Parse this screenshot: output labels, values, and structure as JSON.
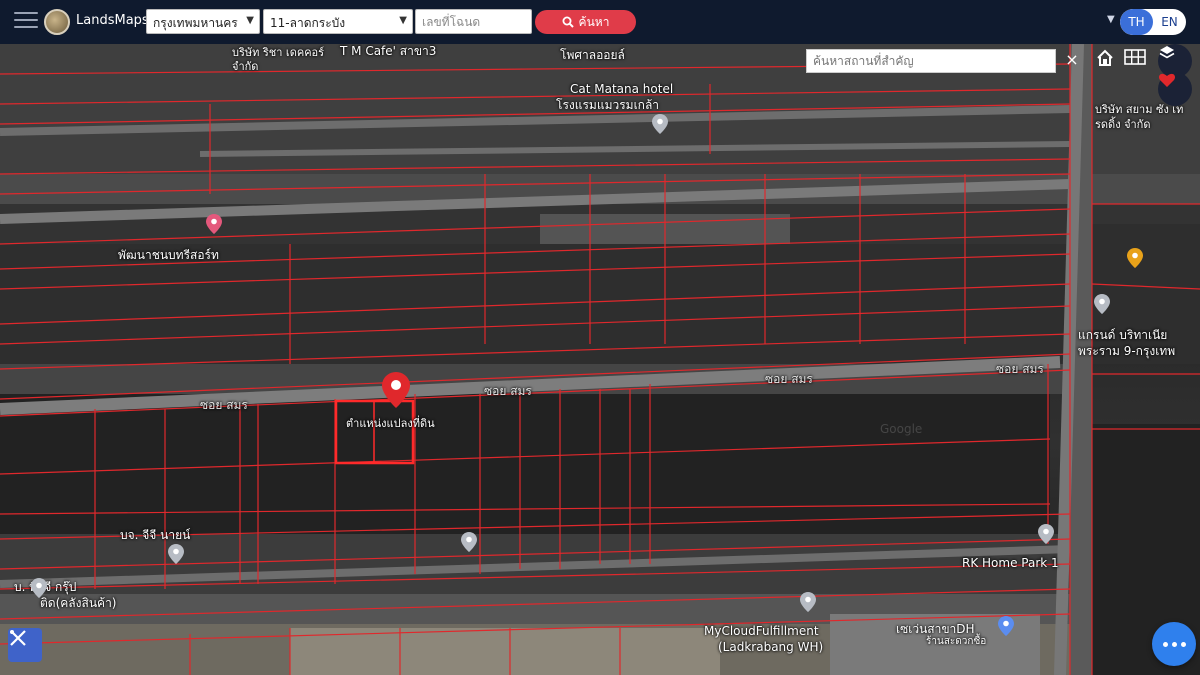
{
  "app": {
    "name": "LandsMaps"
  },
  "topbar": {
    "province": "กรุงเทพมหานคร",
    "district": "11-ลาดกระบัง",
    "deed_placeholder": "เลขที่โฉนด",
    "search_label": "ค้นหา",
    "lang_th": "TH",
    "lang_en": "EN"
  },
  "map": {
    "place_search_placeholder": "ค้นหาสถานที่สำคัญ",
    "close_label": "×",
    "parcel_marker_label": "ตำแหน่งแปลงที่ดิน",
    "labels": {
      "cafe": "T M Cafe' สาขา3",
      "decor": "บริษัท ริชา เดคคอร์ จำกัด",
      "hospital": "โพศาลออยล์",
      "cat_hotel_en": "Cat Matana hotel",
      "cat_hotel_th": "โรงแรมแมวรมเกล้า",
      "resort": "พัฒนาชนบทรีสอร์ท",
      "company_right": "บริษัท สยาม ซัง เทรดดิ้ง จำกัด",
      "grand_1": "แกรนด์ บริทาเนีย",
      "grand_2": "พระราม 9-กรุงเทพ",
      "soi_1": "ซอย สมร",
      "soi_2": "ซอย สมร",
      "soi_3": "ซอย สมร",
      "soi_4": "ซอย สมร",
      "gg_motor": "บจ. จีจี นายน์",
      "rk_home": "RK Home Park 1",
      "tgg_1": "บ. ทีจีจี กรุ๊ป",
      "tgg_2": "ติด(คลังสินค้า)",
      "mycloud_1": "MyCloudFulfillment",
      "mycloud_2": "(Ladkrabang WH)",
      "seven_1": "เซเว่นสาขาDH",
      "seven_2": "ร้านสะดวกซื้อ",
      "watermark": "Google"
    }
  },
  "colors": {
    "topbar": "#0f1a2e",
    "search_button": "#e03c49",
    "parcel_line": "#e0282c",
    "lang_active": "#3b6fd9",
    "chat": "#2f80ed"
  },
  "icons": [
    "menu-icon",
    "search-icon",
    "home-icon",
    "grid-icon",
    "layers-icon",
    "heart-icon",
    "close-icon",
    "tools-icon",
    "chat-icon",
    "location-pin-icon"
  ]
}
